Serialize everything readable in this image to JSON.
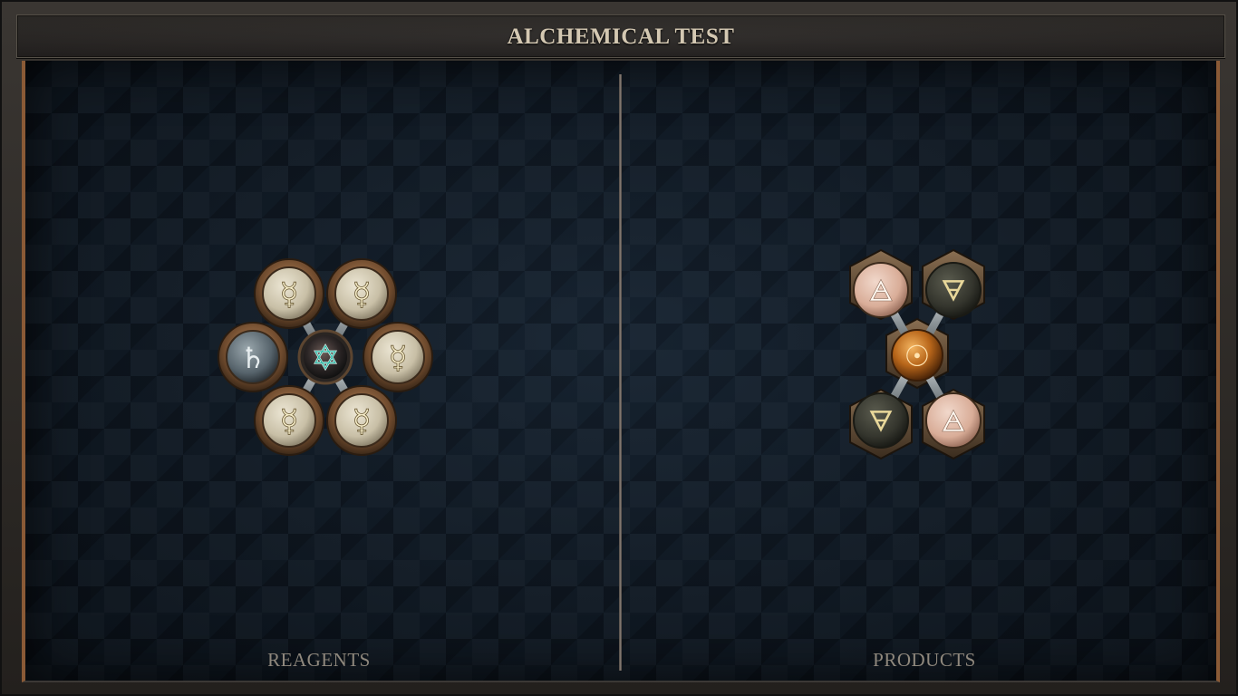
{
  "header": {
    "title": "ALCHEMICAL TEST"
  },
  "panels": {
    "reagents": {
      "label": "REAGENTS",
      "center_atom": {
        "symbol": "✡",
        "icon": "vitae-star-icon"
      },
      "atoms": [
        {
          "symbol": "☿",
          "icon": "quicksilver-icon"
        },
        {
          "symbol": "☿",
          "icon": "quicksilver-icon"
        },
        {
          "symbol": "♄",
          "icon": "lead-icon"
        },
        {
          "symbol": "☿",
          "icon": "quicksilver-icon"
        },
        {
          "symbol": "☿",
          "icon": "quicksilver-icon"
        },
        {
          "symbol": "☿",
          "icon": "quicksilver-icon"
        }
      ]
    },
    "products": {
      "label": "PRODUCTS",
      "center_atom": {
        "symbol": "☉",
        "icon": "gold-icon"
      },
      "atoms": [
        {
          "symbol": "🜁",
          "icon": "air-icon"
        },
        {
          "symbol": "🜃",
          "icon": "earth-icon"
        },
        {
          "symbol": "🜃",
          "icon": "earth-icon"
        },
        {
          "symbol": "🜁",
          "icon": "air-icon"
        }
      ]
    }
  },
  "colors": {
    "accent_copper": "#8a5a36",
    "quicksilver": "#d8d1bd",
    "lead": "#6f7c84",
    "gold": "#c8781e",
    "air": "#e6c3b2",
    "earth": "#3e3f36"
  }
}
